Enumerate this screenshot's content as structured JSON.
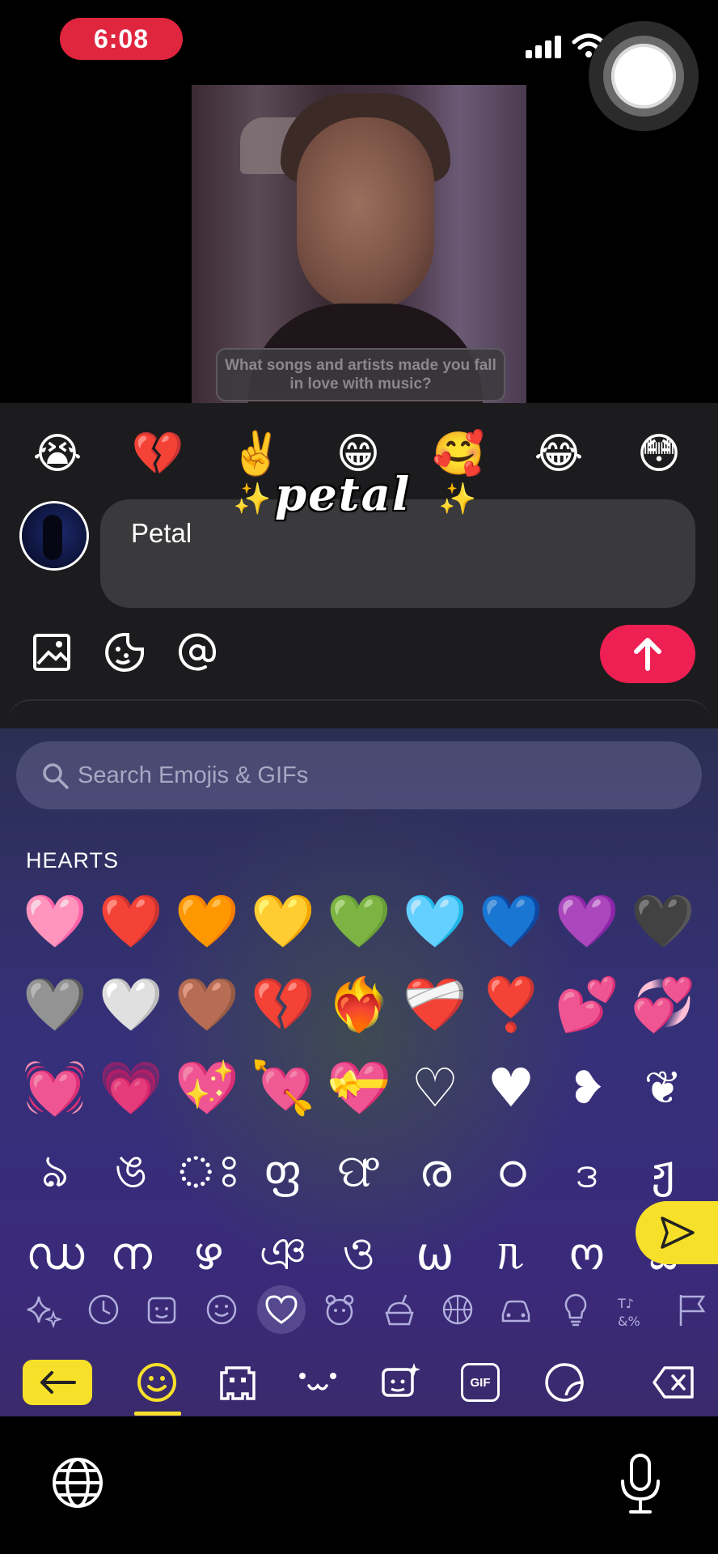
{
  "status_bar": {
    "time": "6:08"
  },
  "video": {
    "caption": "What songs and artists made you fall in love with music?"
  },
  "quick_emojis": [
    "😭",
    "💔",
    "✌️",
    "😁",
    "🥰",
    "😂",
    "😳"
  ],
  "composer": {
    "sticker_text": "petal",
    "sparkle_left": "✨",
    "sparkle_right": "✨",
    "message": "Petal"
  },
  "keyboard": {
    "search_placeholder": "Search Emojis & GIFs",
    "section_title": "HEARTS",
    "emoji_rows": [
      [
        "🩷",
        "❤️",
        "🧡",
        "💛",
        "💚",
        "🩵",
        "💙",
        "💜",
        "🖤"
      ],
      [
        "🩶",
        "🤍",
        "🤎",
        "💔",
        "❤️‍🔥",
        "❤️‍🩹",
        "❣️",
        "💕",
        "💞"
      ],
      [
        "💓",
        "💗",
        "💖",
        "💘",
        "💝",
        "♡",
        "♥",
        "❥",
        "❦"
      ]
    ],
    "glyph_rows": [
      [
        "ঌ",
        "ঙ",
        "ঃ",
        "ფ",
        "ଫ",
        "ര",
        "ഠ",
        "ဒ",
        "ჟ"
      ],
      [
        "ഡ",
        "ന",
        "ഴ",
        "ঞ",
        "ও",
        "ω",
        "ᥰ",
        "ო",
        "ಜ"
      ]
    ],
    "bottom_tabs": [
      "GIF"
    ],
    "accent": "#f7e02a"
  },
  "colors": {
    "send": "#ee1f52",
    "time_pill": "#e0253f"
  }
}
